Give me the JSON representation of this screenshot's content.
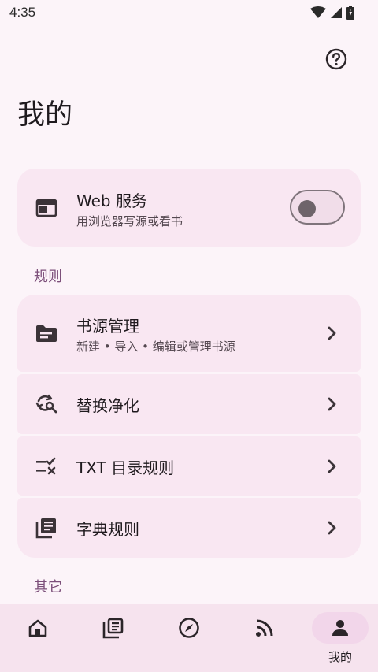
{
  "status_bar": {
    "time": "4:35"
  },
  "header": {
    "title": "我的",
    "help_icon": "help-circle-icon"
  },
  "web_service": {
    "title": "Web 服务",
    "subtitle": "用浏览器写源或看书",
    "enabled": false,
    "icon": "web-window-icon"
  },
  "sections": {
    "rules_label": "规则",
    "other_label": "其它"
  },
  "rules": [
    {
      "title": "书源管理",
      "subtitle": "新建 • 导入 • 编辑或管理书源",
      "icon": "folder-icon"
    },
    {
      "title": "替换净化",
      "icon": "replace-search-icon"
    },
    {
      "title": "TXT 目录规则",
      "icon": "toc-rule-icon"
    },
    {
      "title": "字典规则",
      "icon": "dictionary-icon"
    }
  ],
  "bottom_nav": {
    "items": [
      {
        "icon": "home-icon",
        "label": ""
      },
      {
        "icon": "library-icon",
        "label": ""
      },
      {
        "icon": "compass-icon",
        "label": ""
      },
      {
        "icon": "rss-icon",
        "label": ""
      },
      {
        "icon": "person-icon",
        "label": "我的",
        "active": true
      }
    ]
  },
  "colors": {
    "background": "#fcf4f9",
    "card": "#f9e7f2",
    "accent": "#7c4f7a",
    "nav_active_pill": "#f2d6ea"
  }
}
